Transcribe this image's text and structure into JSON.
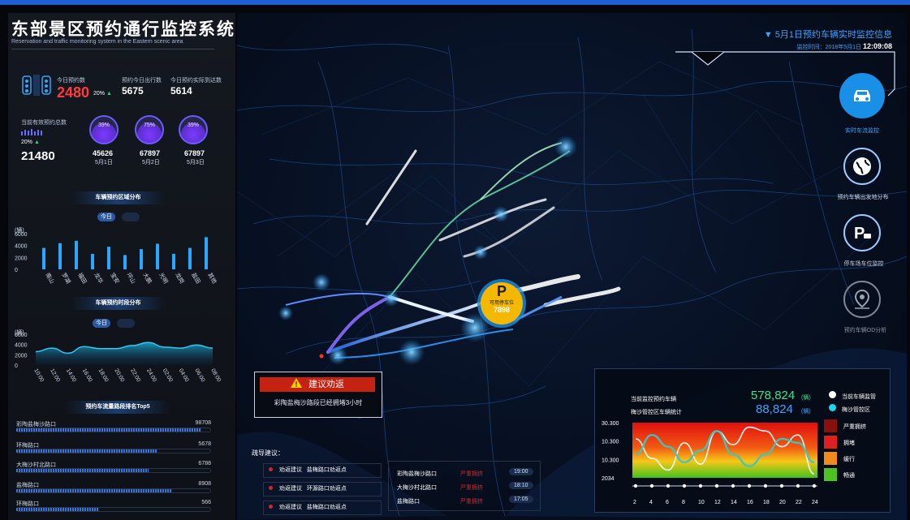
{
  "header": {
    "title": "东部景区预约通行监控系统",
    "subtitle": "Reservation and traffic monitoring system in the Eastern scenic area"
  },
  "stats": {
    "today_label": "今日预约数",
    "today_value": "2480",
    "today_pct": "20%",
    "today_pct_arrow": "▲",
    "trips_label": "预约今日出行数",
    "trips_value": "5675",
    "arrived_label": "今日预约实际到达数",
    "arrived_value": "5614",
    "total_label": "当前有效预约总数",
    "total_pct": "20%",
    "total_pct_arrow": "▲",
    "total_value": "21480",
    "circles": [
      {
        "pct": "39%",
        "value": "45626",
        "date": "5月1日"
      },
      {
        "pct": "75%",
        "value": "67897",
        "date": "5月2日"
      },
      {
        "pct": "39%",
        "value": "67897",
        "date": "5月3日"
      }
    ]
  },
  "area_section": {
    "title": "车辆预约区域分布",
    "tab_today": "今日",
    "tab_other": "",
    "unit": "(辆)"
  },
  "time_section": {
    "title": "车辆预约时段分布",
    "tab_today": "今日",
    "tab_other": "",
    "unit": "(辆)"
  },
  "chart_data": [
    {
      "type": "bar",
      "title": "车辆预约区域分布",
      "ylabel": "(辆)",
      "ylim": [
        0,
        6000
      ],
      "yticks": [
        "6000",
        "4000",
        "2000",
        "0"
      ],
      "categories": [
        "南山",
        "罗湖",
        "福田",
        "龙华",
        "宝安",
        "坪山",
        "大鹏",
        "光明",
        "龙岗",
        "盐田",
        "其他"
      ],
      "values": [
        3600,
        4400,
        4800,
        2600,
        3800,
        2400,
        3400,
        4300,
        2600,
        3600,
        5400
      ]
    },
    {
      "type": "area",
      "title": "车辆预约时段分布",
      "ylabel": "(辆)",
      "ylim": [
        0,
        6000
      ],
      "yticks": [
        "6000",
        "4000",
        "2000",
        "0"
      ],
      "x": [
        "10:00",
        "12:00",
        "14:00",
        "16:00",
        "18:00",
        "20:00",
        "22:00",
        "24:00",
        "02:00",
        "04:00",
        "06:00",
        "08:00"
      ],
      "values": [
        2600,
        3300,
        2300,
        3600,
        3200,
        3200,
        3800,
        4400,
        3500,
        3300,
        3900,
        3300
      ]
    },
    {
      "type": "line",
      "title": "当前监控预约车辆",
      "ylim": [
        2034,
        30300
      ],
      "yticks": [
        "30.300",
        "10.300",
        "10.300",
        "2034"
      ],
      "x": [
        2,
        4,
        6,
        8,
        10,
        12,
        14,
        16,
        18,
        20,
        22,
        24
      ],
      "series": [
        {
          "name": "当前车辆监管",
          "values": [
            22000,
            12000,
            6000,
            20000,
            9000,
            26000,
            19000,
            28000,
            26000,
            18000,
            24000,
            4000
          ]
        },
        {
          "name": "梅沙管控区",
          "values": [
            14000,
            24000,
            18000,
            10000,
            16000,
            26000,
            14000,
            8000,
            14000,
            22000,
            20000,
            10000
          ]
        }
      ]
    }
  ],
  "routes": {
    "title": "预约车流量路段排名Top5",
    "items": [
      {
        "name": "彩陶盐梅沙路口",
        "value": "98708",
        "ratio": 0.95
      },
      {
        "name": "环梅路口",
        "value": "5678",
        "ratio": 0.72
      },
      {
        "name": "大梅沙村北路口",
        "value": "6788",
        "ratio": 0.68
      },
      {
        "name": "盐梅路口",
        "value": "8908",
        "ratio": 0.8
      },
      {
        "name": "环梅路口",
        "value": "566",
        "ratio": 0.42
      }
    ]
  },
  "map": {
    "header_title": "▼ 5月1日预约车辆实时监控信息",
    "monitor_time_label": "监控时间：2018年5月1日",
    "monitor_time_clock": "12:09:08",
    "parking_letter": "P",
    "parking_label": "可用停车位",
    "parking_value": "7898"
  },
  "right_nav": [
    {
      "label": "实时车流监控",
      "icon": "car-icon"
    },
    {
      "label": "预约车辆出发地分布",
      "icon": "globe-icon"
    },
    {
      "label": "停车场车位监控",
      "icon": "parking-icon"
    },
    {
      "label": "预约车辆OD分析",
      "icon": "location-icon"
    }
  ],
  "alert": {
    "icon": "warning-icon",
    "title": "建议劝返",
    "message": "彩陶盐梅沙路段已经拥堵3小时"
  },
  "suggestions": {
    "title": "疏导建议：",
    "items": [
      {
        "action": "劝返建议",
        "target": "盐梅路口劝返点"
      },
      {
        "action": "劝返建议",
        "target": "环源路口劝返点"
      },
      {
        "action": "劝返建议",
        "target": "盐梅路口劝返点"
      }
    ]
  },
  "congestion": [
    {
      "road": "彩陶盐梅沙路口",
      "status": "严重拥挤",
      "time": "19:00"
    },
    {
      "road": "大梅沙村北路口",
      "status": "严重拥挤",
      "time": "18:10"
    },
    {
      "road": "盐梅路口",
      "status": "严重拥挤",
      "time": "17:05"
    }
  ],
  "panel": {
    "label1": "当前监控预约车辆",
    "label2": "梅沙管控区车辆统计",
    "value1": "578,824",
    "value2": "88,824",
    "unit": "(辆)",
    "legend1": "当前车辆监管",
    "legend2": "梅沙管控区",
    "levels": [
      {
        "label": "严重拥挤",
        "color": "#8a1010"
      },
      {
        "label": "拥堵",
        "color": "#e02020"
      },
      {
        "label": "缓行",
        "color": "#f08a1a"
      },
      {
        "label": "畅通",
        "color": "#4ec21e"
      }
    ]
  },
  "colors": {
    "accent": "#1e5fd6",
    "highlight": "#3aa4ff",
    "danger": "#e02020"
  }
}
